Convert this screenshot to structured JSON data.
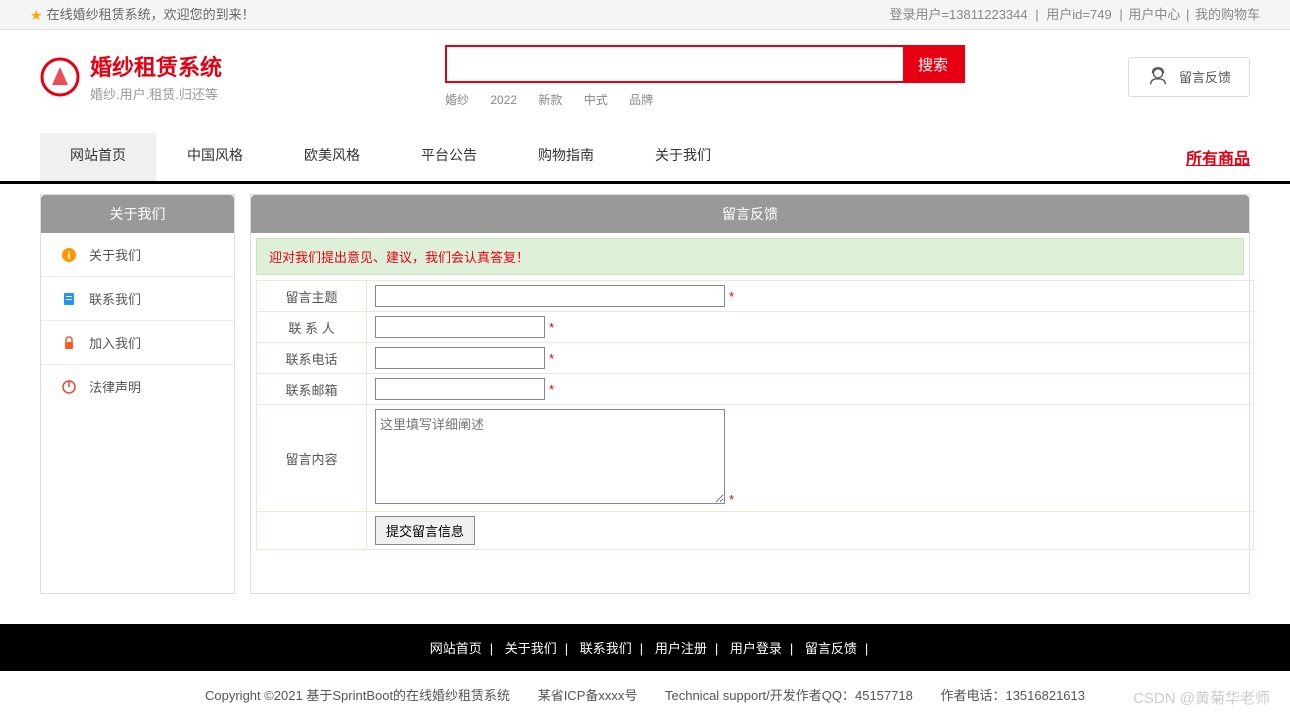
{
  "topbar": {
    "welcome": "在线婚纱租赁系统，欢迎您的到来！",
    "login_user": "登录用户=13811223344",
    "user_id": "用户id=749",
    "user_center": "用户中心",
    "my_cart": "我的购物车"
  },
  "header": {
    "title": "婚纱租赁系统",
    "subtitle": "婚纱.用户.租赁.归还等",
    "search_btn": "搜索",
    "feedback_btn": "留言反馈",
    "tags": [
      "婚纱",
      "2022",
      "新款",
      "中式",
      "品牌"
    ]
  },
  "nav": {
    "items": [
      "网站首页",
      "中国风格",
      "欧美风格",
      "平台公告",
      "购物指南",
      "关于我们"
    ],
    "all_products": "所有商品"
  },
  "sidebar": {
    "title": "关于我们",
    "items": [
      {
        "label": "关于我们",
        "icon": "info"
      },
      {
        "label": "联系我们",
        "icon": "clipboard"
      },
      {
        "label": "加入我们",
        "icon": "lock"
      },
      {
        "label": "法律声明",
        "icon": "power"
      }
    ]
  },
  "content": {
    "title": "留言反馈",
    "notice": "迎对我们提出意见、建议，我们会认真答复！",
    "form": {
      "subject_label": "留言主题",
      "contact_label": "联 系 人",
      "phone_label": "联系电话",
      "email_label": "联系邮箱",
      "content_label": "留言内容",
      "textarea_placeholder": "这里填写详细阐述",
      "submit_btn": "提交留言信息",
      "required_mark": "*"
    }
  },
  "footer": {
    "nav_items": [
      "网站首页",
      "关于我们",
      "联系我们",
      "用户注册",
      "用户登录",
      "留言反馈"
    ],
    "copyright": "Copyright ©2021 基于SprintBoot的在线婚纱租赁系统",
    "icp": "某省ICP备xxxx号",
    "support": "Technical support/开发作者QQ：45157718",
    "phone": "作者电话：13516821613",
    "watermark": "CSDN @黄菊华老师"
  }
}
